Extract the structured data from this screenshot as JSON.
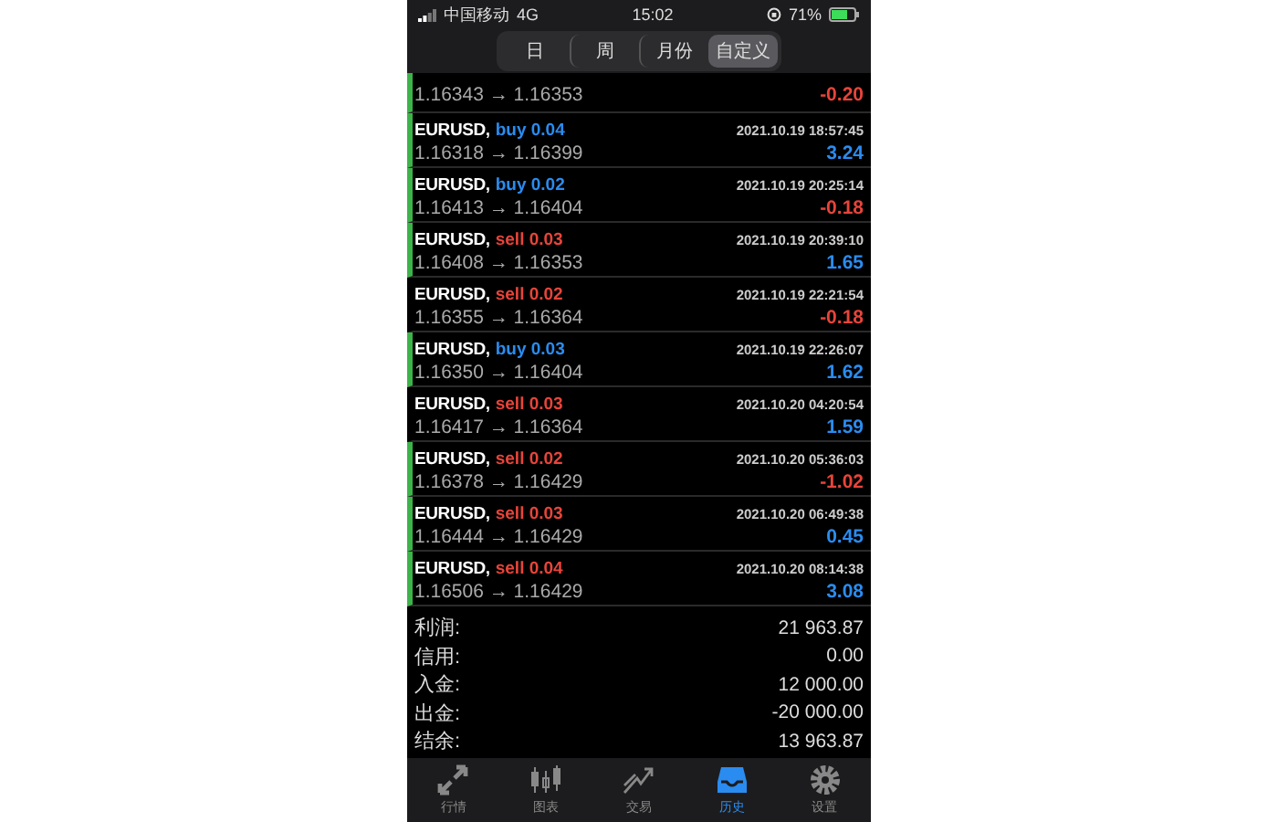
{
  "status_bar": {
    "carrier": "中国移动",
    "network": "4G",
    "time": "15:02",
    "battery": "71%"
  },
  "periods": [
    {
      "label": "日",
      "selected": false
    },
    {
      "label": "周",
      "selected": false
    },
    {
      "label": "月份",
      "selected": false
    },
    {
      "label": "自定义",
      "selected": true
    }
  ],
  "partial_deal": {
    "prices": "1.16343 → 1.16353",
    "profit": {
      "text": "-0.20",
      "color": "#e8443a"
    },
    "marked": true
  },
  "deals": [
    {
      "symbol": "EURUSD,",
      "volume": {
        "text": "buy 0.04",
        "color": "#2a8cf0"
      },
      "time": "2021.10.19 18:57:45",
      "prices": "1.16318 → 1.16399",
      "profit": {
        "text": "3.24",
        "color": "#2a8cf0"
      },
      "marked": true
    },
    {
      "symbol": "EURUSD,",
      "volume": {
        "text": "buy 0.02",
        "color": "#2a8cf0"
      },
      "time": "2021.10.19 20:25:14",
      "prices": "1.16413 → 1.16404",
      "profit": {
        "text": "-0.18",
        "color": "#e8443a"
      },
      "marked": true
    },
    {
      "symbol": "EURUSD,",
      "volume": {
        "text": "sell 0.03",
        "color": "#e8443a"
      },
      "time": "2021.10.19 20:39:10",
      "prices": "1.16408 → 1.16353",
      "profit": {
        "text": "1.65",
        "color": "#2a8cf0"
      },
      "marked": true
    },
    {
      "symbol": "EURUSD,",
      "volume": {
        "text": "sell 0.02",
        "color": "#e8443a"
      },
      "time": "2021.10.19 22:21:54",
      "prices": "1.16355 → 1.16364",
      "profit": {
        "text": "-0.18",
        "color": "#e8443a"
      },
      "marked": false
    },
    {
      "symbol": "EURUSD,",
      "volume": {
        "text": "buy 0.03",
        "color": "#2a8cf0"
      },
      "time": "2021.10.19 22:26:07",
      "prices": "1.16350 → 1.16404",
      "profit": {
        "text": "1.62",
        "color": "#2a8cf0"
      },
      "marked": true
    },
    {
      "symbol": "EURUSD,",
      "volume": {
        "text": "sell 0.03",
        "color": "#e8443a"
      },
      "time": "2021.10.20 04:20:54",
      "prices": "1.16417 → 1.16364",
      "profit": {
        "text": "1.59",
        "color": "#2a8cf0"
      },
      "marked": false
    },
    {
      "symbol": "EURUSD,",
      "volume": {
        "text": "sell 0.02",
        "color": "#e8443a"
      },
      "time": "2021.10.20 05:36:03",
      "prices": "1.16378 → 1.16429",
      "profit": {
        "text": "-1.02",
        "color": "#e8443a"
      },
      "marked": true
    },
    {
      "symbol": "EURUSD,",
      "volume": {
        "text": "sell 0.03",
        "color": "#e8443a"
      },
      "time": "2021.10.20 06:49:38",
      "prices": "1.16444 → 1.16429",
      "profit": {
        "text": "0.45",
        "color": "#2a8cf0"
      },
      "marked": true
    },
    {
      "symbol": "EURUSD,",
      "volume": {
        "text": "sell 0.04",
        "color": "#e8443a"
      },
      "time": "2021.10.20 08:14:38",
      "prices": "1.16506 → 1.16429",
      "profit": {
        "text": "3.08",
        "color": "#2a8cf0"
      },
      "marked": true
    }
  ],
  "summary": [
    {
      "label": "利润:",
      "value": "21 963.87"
    },
    {
      "label": "信用:",
      "value": "0.00"
    },
    {
      "label": "入金:",
      "value": "12 000.00"
    },
    {
      "label": "出金:",
      "value": "-20 000.00"
    },
    {
      "label": "结余:",
      "value": "13 963.87"
    }
  ],
  "tabs": [
    {
      "kind": "quotes",
      "label": "行情",
      "selected": false
    },
    {
      "kind": "chart",
      "label": "图表",
      "selected": false
    },
    {
      "kind": "trade",
      "label": "交易",
      "selected": false
    },
    {
      "kind": "history",
      "label": "历史",
      "selected": true
    },
    {
      "kind": "settings",
      "label": "设置",
      "selected": false
    }
  ]
}
